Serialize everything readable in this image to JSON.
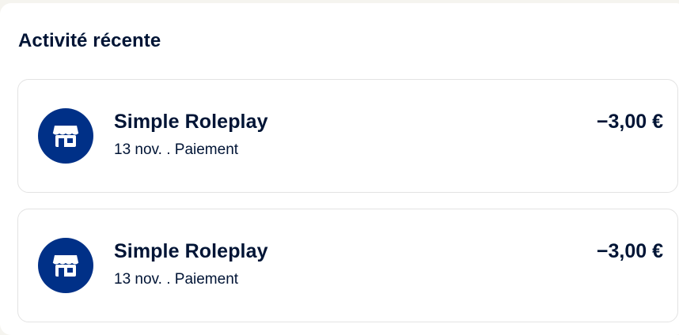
{
  "colors": {
    "accent": "#003087",
    "text": "#001435",
    "border": "#e3e3e3",
    "background": "#ffffff"
  },
  "section": {
    "title": "Activité récente"
  },
  "transactions": [
    {
      "icon": "storefront-icon",
      "merchant": "Simple Roleplay",
      "date": "13 nov.",
      "separator": ".",
      "type": "Paiement",
      "amount": "−3,00 €"
    },
    {
      "icon": "storefront-icon",
      "merchant": "Simple Roleplay",
      "date": "13 nov.",
      "separator": ".",
      "type": "Paiement",
      "amount": "−3,00 €"
    }
  ]
}
